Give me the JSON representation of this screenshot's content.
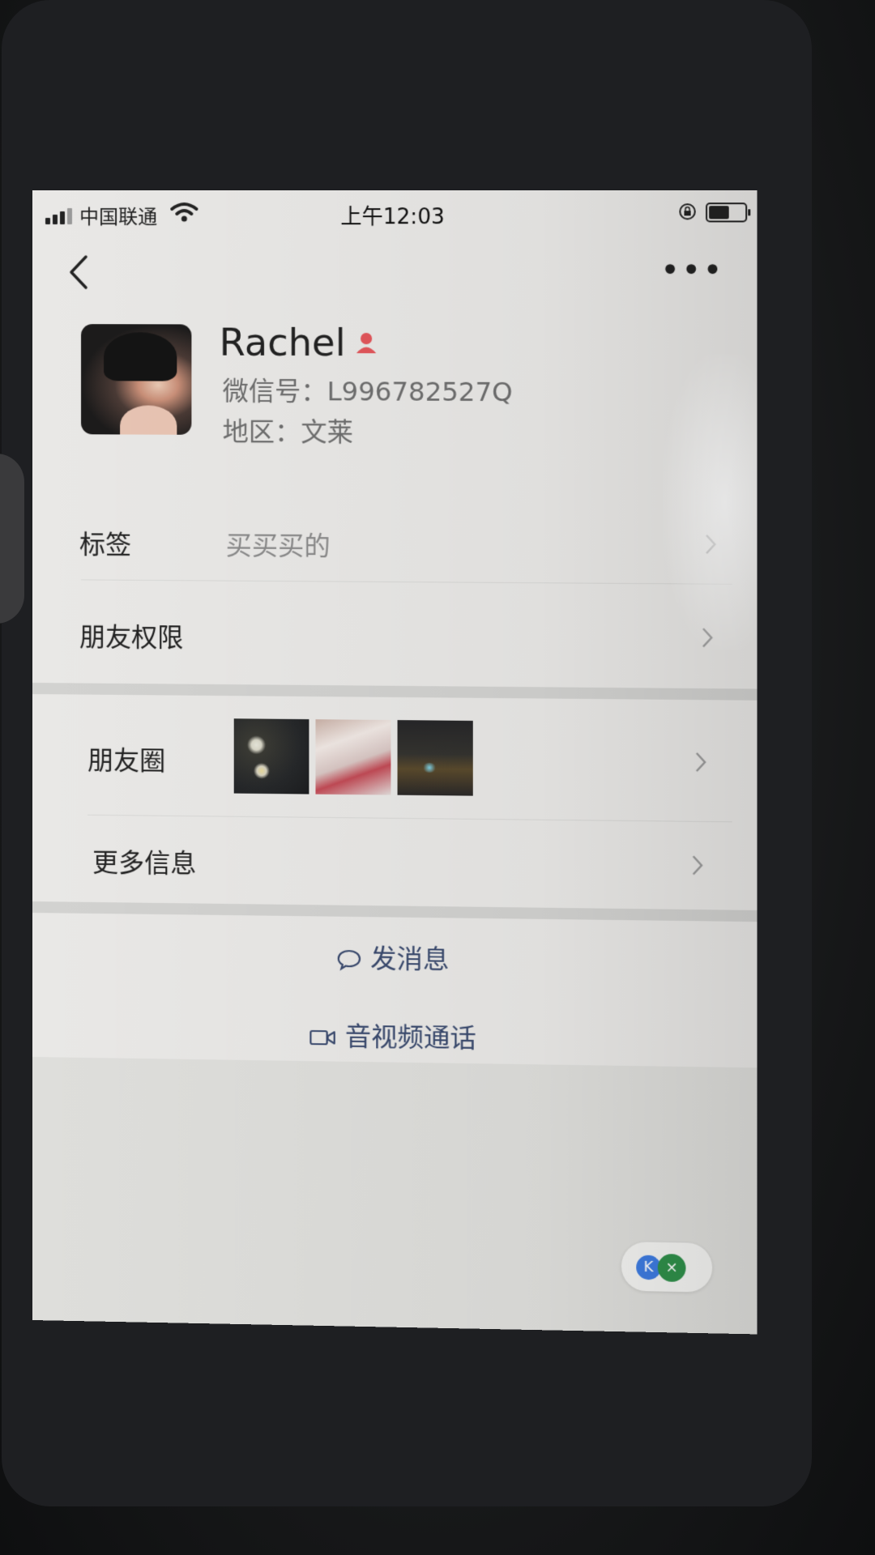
{
  "status_bar": {
    "carrier": "中国联通",
    "time": "上午12:03"
  },
  "profile": {
    "name": "Rachel",
    "wechat_id": "微信号：L996782527Q",
    "region": "地区：文莱"
  },
  "rows": {
    "tags_label": "标签",
    "tags_value": "买买买的",
    "permissions_label": "朋友权限",
    "moments_label": "朋友圈",
    "more_info_label": "更多信息"
  },
  "actions": {
    "send_message": "发消息",
    "av_call": "音视频通话"
  },
  "colors": {
    "screen_bg": "#e9e8e6",
    "action_text": "#3a4a6e",
    "gender_icon": "#e2555a"
  }
}
